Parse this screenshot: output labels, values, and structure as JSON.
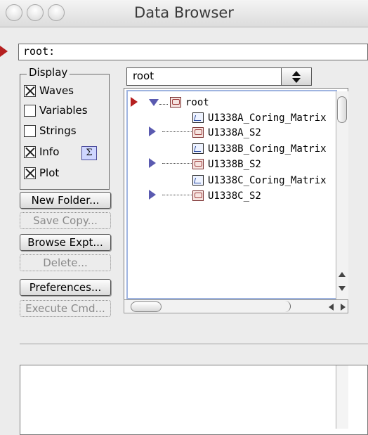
{
  "window": {
    "title": "Data Browser"
  },
  "path": {
    "value": "root:"
  },
  "display": {
    "legend": "Display",
    "options": [
      {
        "label": "Waves",
        "checked": true
      },
      {
        "label": "Variables",
        "checked": false
      },
      {
        "label": "Strings",
        "checked": false
      },
      {
        "label": "Info",
        "checked": true
      },
      {
        "label": "Plot",
        "checked": true
      }
    ],
    "sigma_label": "Σ"
  },
  "buttons": [
    {
      "label": "New Folder...",
      "enabled": true
    },
    {
      "label": "Save Copy...",
      "enabled": false
    },
    {
      "label": "Browse Expt...",
      "enabled": true
    },
    {
      "label": "Delete...",
      "enabled": false
    },
    {
      "label": "Preferences...",
      "enabled": true
    },
    {
      "label": "Execute Cmd...",
      "enabled": false
    }
  ],
  "folder_select": {
    "value": "root"
  },
  "tree": {
    "items": [
      {
        "label": "root",
        "type": "folder",
        "expanded": true,
        "selected": true
      },
      {
        "label": "U1338A_Coring_Matrix",
        "type": "wave"
      },
      {
        "label": "U1338A_S2",
        "type": "folder",
        "expanded": false
      },
      {
        "label": "U1338B_Coring_Matrix",
        "type": "wave"
      },
      {
        "label": "U1338B_S2",
        "type": "folder",
        "expanded": false
      },
      {
        "label": "U1338C_Coring_Matrix",
        "type": "wave"
      },
      {
        "label": "U1338C_S2",
        "type": "folder",
        "expanded": false
      }
    ]
  },
  "colors": {
    "accent_arrow": "#b52020",
    "disclosure": "#5a5ab0",
    "focus_ring": "#9fb4e0"
  }
}
